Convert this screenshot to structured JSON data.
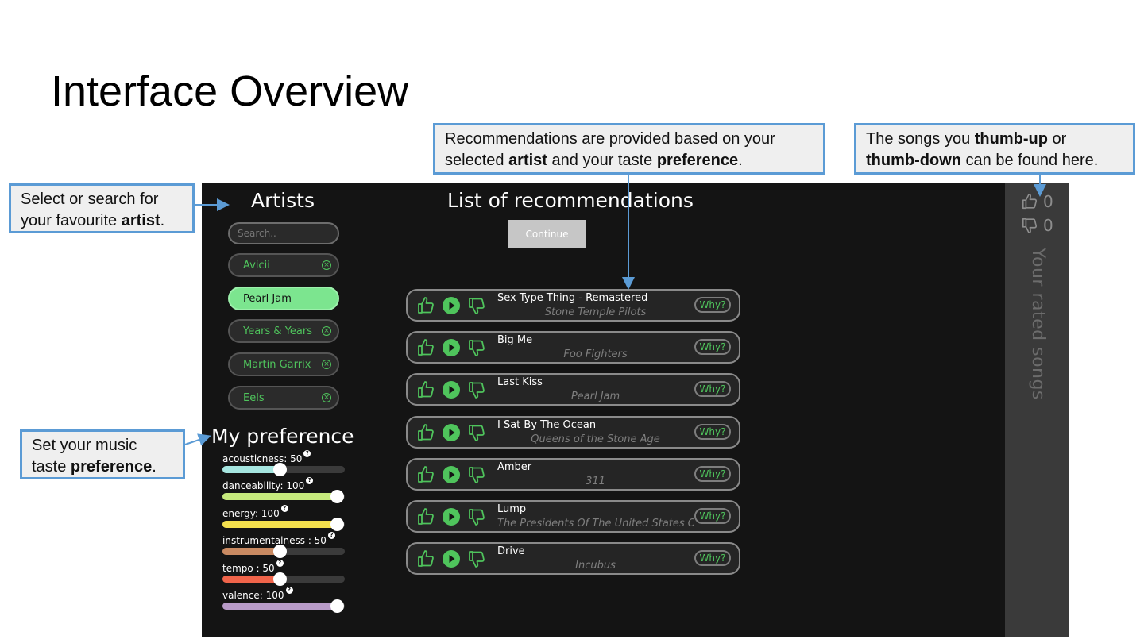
{
  "slide": {
    "title": "Interface Overview"
  },
  "callouts": {
    "artist": {
      "pre": "Select or search for your favourite ",
      "bold": "artist",
      "post": "."
    },
    "preference": {
      "pre": "Set your music taste ",
      "bold": "preference",
      "post": "."
    },
    "recommend": {
      "pre": "Recommendations are provided based on your selected ",
      "bold1": "artist",
      "mid": " and your taste ",
      "bold2": "preference",
      "post": "."
    },
    "rated": {
      "pre": "The songs you ",
      "bold1": "thumb-up",
      "mid": " or ",
      "bold2": "thumb-down",
      "post": " can be found here."
    }
  },
  "app": {
    "artists_heading": "Artists",
    "search_placeholder": "Search..",
    "artists": [
      {
        "name": "Avicii",
        "selected": false
      },
      {
        "name": "Pearl Jam",
        "selected": true
      },
      {
        "name": "Years & Years",
        "selected": false
      },
      {
        "name": "Martin Garrix",
        "selected": false
      },
      {
        "name": "Eels",
        "selected": false
      }
    ],
    "recs_heading": "List of recommendations",
    "continue_label": "Continue",
    "why_label": "Why?",
    "recommendations": [
      {
        "title": "Sex Type Thing - Remastered",
        "artist": "Stone Temple Pilots"
      },
      {
        "title": "Big Me",
        "artist": "Foo Fighters"
      },
      {
        "title": "Last Kiss",
        "artist": "Pearl Jam"
      },
      {
        "title": "I Sat By The Ocean",
        "artist": "Queens of the Stone Age"
      },
      {
        "title": "Amber",
        "artist": "311"
      },
      {
        "title": "Lump",
        "artist": "The Presidents Of The United States Of America"
      },
      {
        "title": "Drive",
        "artist": "Incubus"
      }
    ],
    "preference_heading": "My preference",
    "preferences": [
      {
        "label": "acousticness: 50",
        "value": 50,
        "color": "#a6e6e0"
      },
      {
        "label": "danceability: 100",
        "value": 100,
        "color": "#c6ea7c"
      },
      {
        "label": "energy: 100",
        "value": 100,
        "color": "#f4e04d"
      },
      {
        "label": "instrumentalness : 50",
        "value": 50,
        "color": "#c98a62"
      },
      {
        "label": "tempo : 50",
        "value": 50,
        "color": "#f0644a"
      },
      {
        "label": "valence: 100",
        "value": 100,
        "color": "#b89ac7"
      }
    ],
    "rated": {
      "thumbs_up_count": "0",
      "thumbs_down_count": "0",
      "label": "Your rated songs"
    },
    "colors": {
      "accent_green": "#4fc45c",
      "selected_pill": "#7ce58f",
      "callout_border": "#5b9bd5"
    }
  }
}
